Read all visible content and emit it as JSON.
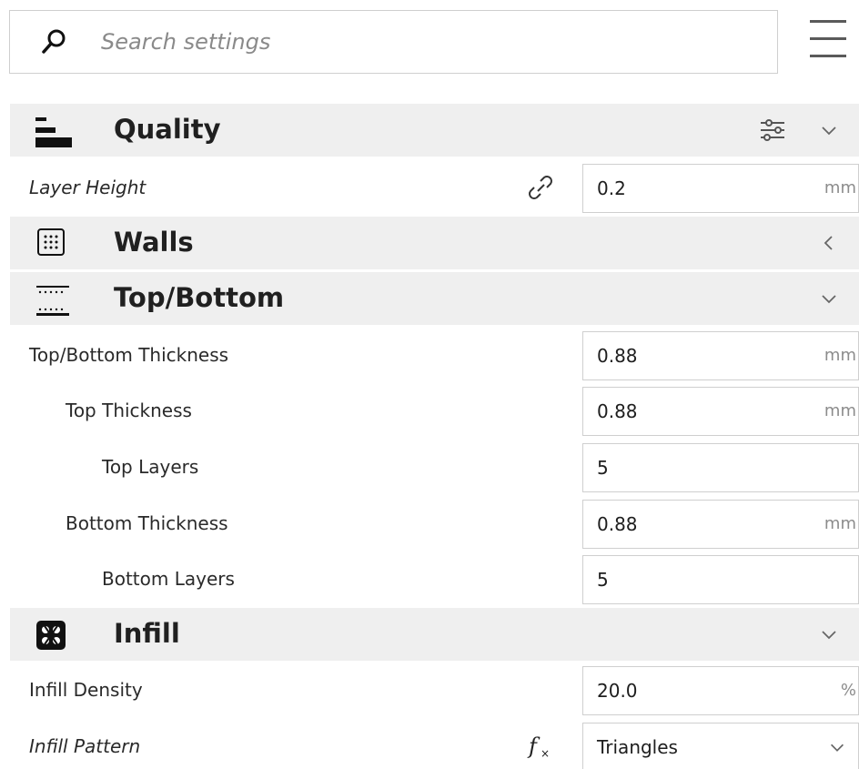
{
  "search": {
    "placeholder": "Search settings"
  },
  "icons": {
    "search": "search-icon",
    "menu": "hamburger-menu-icon",
    "quality": "quality-layers-icon",
    "walls": "walls-grid-icon",
    "top_bottom": "top-bottom-icon",
    "infill": "infill-pattern-icon",
    "settings_adjust": "sliders-icon",
    "link": "link-icon",
    "function": "function-icon",
    "chevron_down": "chevron-down-icon",
    "chevron_left": "chevron-left-icon"
  },
  "categories": {
    "quality": {
      "title": "Quality",
      "expanded": true,
      "settings": [
        {
          "label": "Layer Height",
          "value": "0.2",
          "unit": "mm"
        }
      ]
    },
    "walls": {
      "title": "Walls",
      "expanded": false
    },
    "top_bottom": {
      "title": "Top/Bottom",
      "expanded": true,
      "settings": [
        {
          "label": "Top/Bottom Thickness",
          "value": "0.88",
          "unit": "mm"
        },
        {
          "label": "Top Thickness",
          "value": "0.88",
          "unit": "mm"
        },
        {
          "label": "Top Layers",
          "value": "5",
          "unit": ""
        },
        {
          "label": "Bottom Thickness",
          "value": "0.88",
          "unit": "mm"
        },
        {
          "label": "Bottom Layers",
          "value": "5",
          "unit": ""
        }
      ]
    },
    "infill": {
      "title": "Infill",
      "expanded": true,
      "settings": [
        {
          "label": "Infill Density",
          "value": "20.0",
          "unit": "%"
        },
        {
          "label": "Infill Pattern",
          "value": "Triangles",
          "unit": ""
        }
      ]
    }
  },
  "colors": {
    "category_background": "#efefef",
    "field_border": "#cfcfcf",
    "text": "#202020",
    "muted_text": "#8a8a8a"
  }
}
